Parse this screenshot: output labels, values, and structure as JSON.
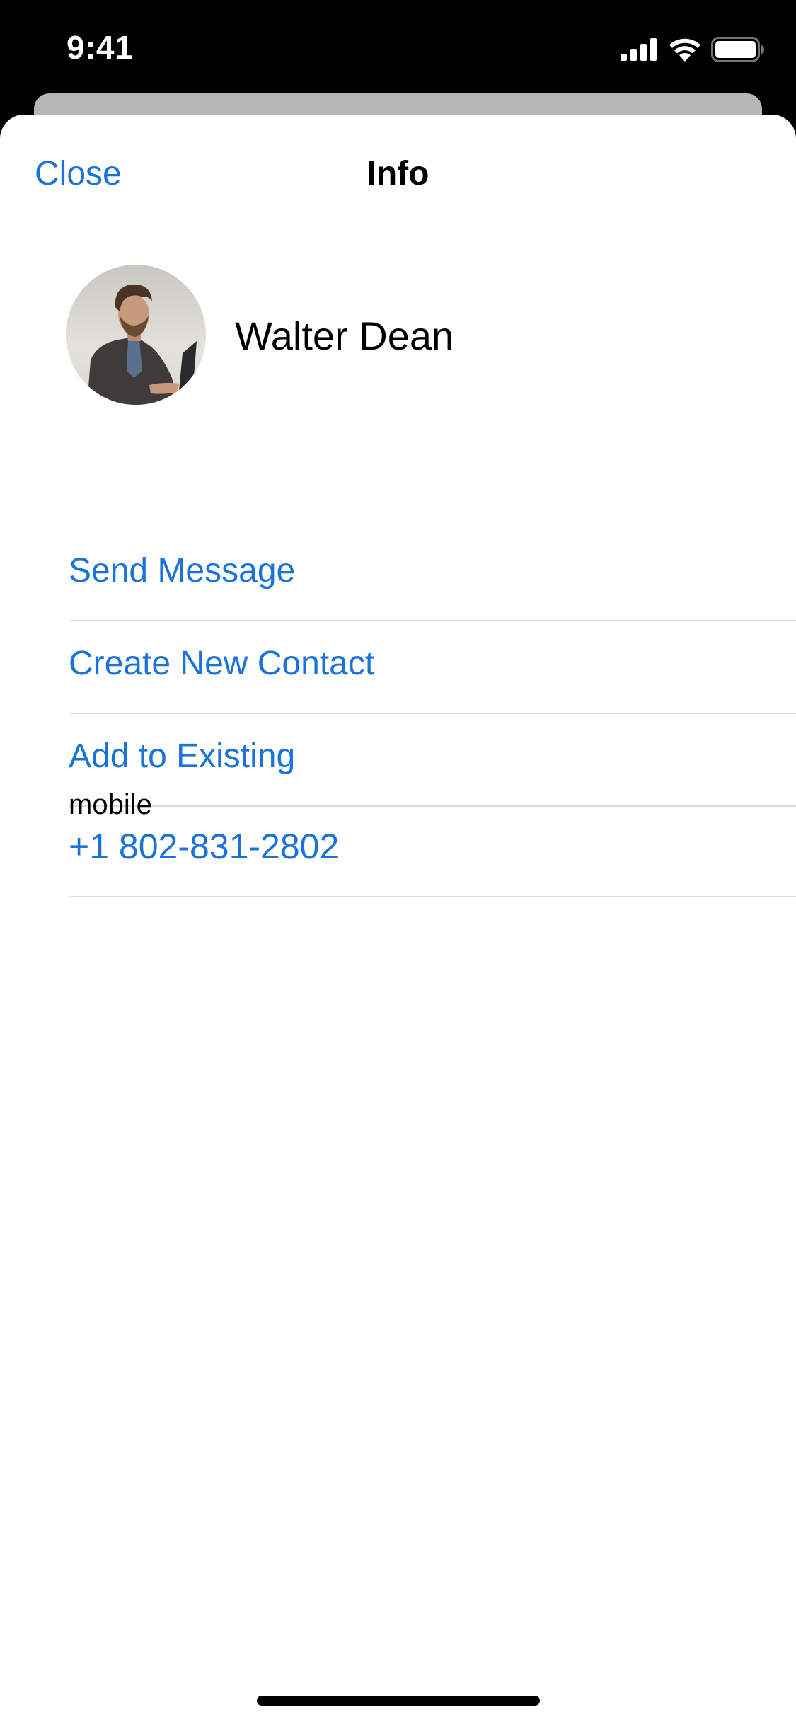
{
  "status_bar": {
    "time": "9:41",
    "icons": [
      "cellular-signal-icon",
      "wifi-icon",
      "battery-icon"
    ]
  },
  "nav": {
    "close_label": "Close",
    "title": "Info"
  },
  "contact": {
    "name": "Walter Dean",
    "avatar": "avatar-photo"
  },
  "actions": [
    {
      "label": "Send Message"
    },
    {
      "label": "Create New Contact"
    },
    {
      "label": "Add to Existing"
    }
  ],
  "phone": {
    "label": "mobile",
    "number": "+1 802-831-2802"
  },
  "colors": {
    "accent": "#1a73d9",
    "separator": "#dcdcdf",
    "background_card": "#b7b7b4"
  }
}
